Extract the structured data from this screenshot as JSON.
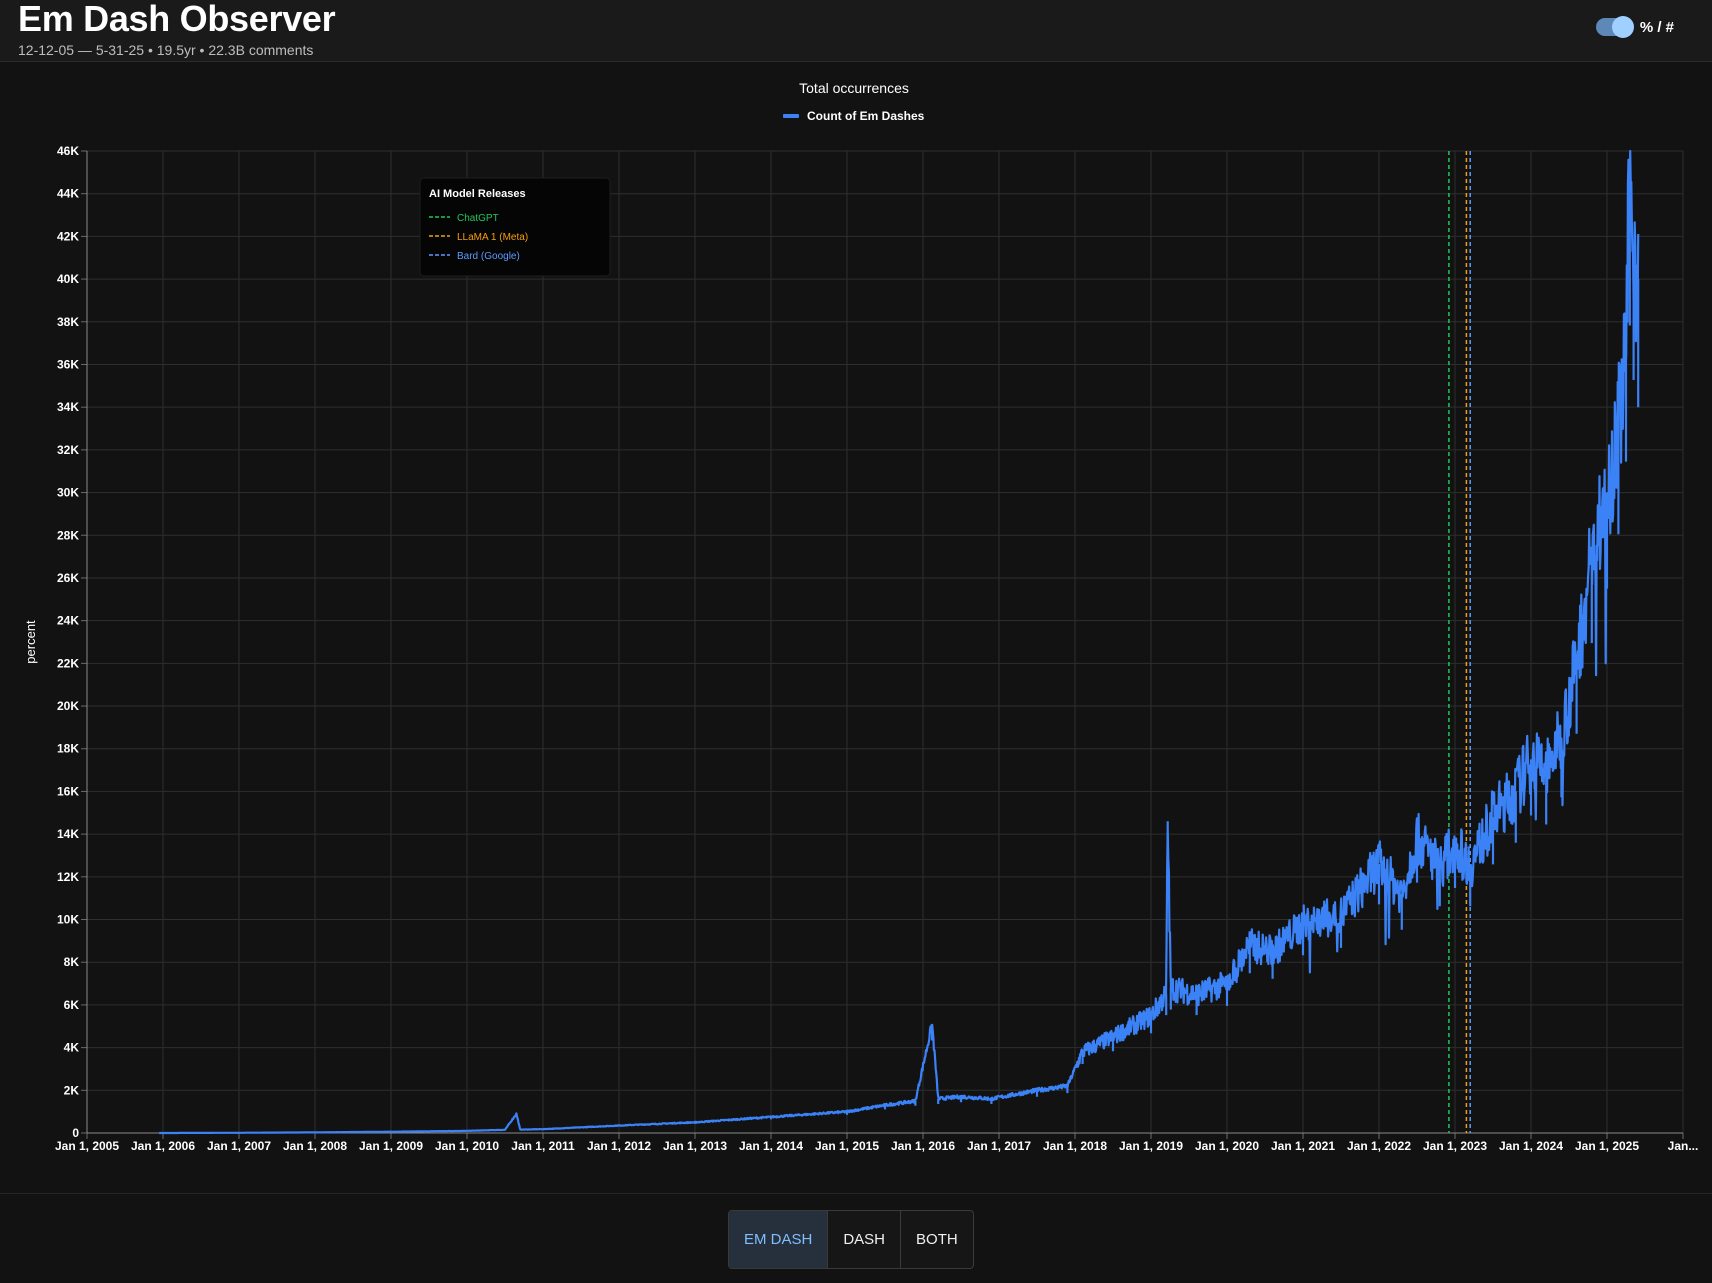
{
  "header": {
    "title": "Em Dash Observer",
    "subtitle": "12-12-05 — 5-31-25 • 19.5yr • 22.3B comments",
    "toggle_label": "% / #"
  },
  "metric_tabs": [
    {
      "label": "EM DASH",
      "active": true
    },
    {
      "label": "DASH",
      "active": false
    },
    {
      "label": "BOTH",
      "active": false
    }
  ],
  "colors": {
    "series": "#3b82f6",
    "chatgpt": "#22c55e",
    "llama": "#f59e0b",
    "bard": "#5b9bff",
    "active_tab_text": "#7fbfff"
  },
  "chart_data": {
    "type": "line",
    "title": "Total occurrences",
    "xlabel": "",
    "ylabel": "percent",
    "legend_position": "top-center",
    "grid": true,
    "xlim": [
      2005.0,
      2026.0
    ],
    "ylim": [
      0,
      46000
    ],
    "x_ticks": [
      "Jan 1, 2005",
      "Jan 1, 2006",
      "Jan 1, 2007",
      "Jan 1, 2008",
      "Jan 1, 2009",
      "Jan 1, 2010",
      "Jan 1, 2011",
      "Jan 1, 2012",
      "Jan 1, 2013",
      "Jan 1, 2014",
      "Jan 1, 2015",
      "Jan 1, 2016",
      "Jan 1, 2017",
      "Jan 1, 2018",
      "Jan 1, 2019",
      "Jan 1, 2020",
      "Jan 1, 2021",
      "Jan 1, 2022",
      "Jan 1, 2023",
      "Jan 1, 2024",
      "Jan 1, 2025",
      "Jan..."
    ],
    "y_ticks": [
      "0",
      "2K",
      "4K",
      "6K",
      "8K",
      "10K",
      "12K",
      "14K",
      "16K",
      "18K",
      "20K",
      "22K",
      "24K",
      "26K",
      "28K",
      "30K",
      "32K",
      "34K",
      "36K",
      "38K",
      "40K",
      "42K",
      "44K",
      "46K"
    ],
    "series": [
      {
        "name": "Count of Em Dashes",
        "points": [
          [
            2005.95,
            0
          ],
          [
            2007.0,
            10
          ],
          [
            2008.0,
            30
          ],
          [
            2009.0,
            60
          ],
          [
            2010.0,
            100
          ],
          [
            2010.5,
            150
          ],
          [
            2010.65,
            900
          ],
          [
            2010.7,
            160
          ],
          [
            2011.0,
            180
          ],
          [
            2012.0,
            350
          ],
          [
            2013.0,
            500
          ],
          [
            2014.0,
            750
          ],
          [
            2015.0,
            1000
          ],
          [
            2015.5,
            1300
          ],
          [
            2015.9,
            1500
          ],
          [
            2016.12,
            5100
          ],
          [
            2016.2,
            1600
          ],
          [
            2016.5,
            1700
          ],
          [
            2016.9,
            1600
          ],
          [
            2017.5,
            2000
          ],
          [
            2017.9,
            2200
          ],
          [
            2018.1,
            3800
          ],
          [
            2018.5,
            4500
          ],
          [
            2019.0,
            5500
          ],
          [
            2019.2,
            6500
          ],
          [
            2019.22,
            14600
          ],
          [
            2019.26,
            6800
          ],
          [
            2019.6,
            6500
          ],
          [
            2020.0,
            7000
          ],
          [
            2020.3,
            8800
          ],
          [
            2020.6,
            8500
          ],
          [
            2021.0,
            9800
          ],
          [
            2021.5,
            10200
          ],
          [
            2022.0,
            12600
          ],
          [
            2022.3,
            11200
          ],
          [
            2022.5,
            13800
          ],
          [
            2022.8,
            12500
          ],
          [
            2023.0,
            13500
          ],
          [
            2023.2,
            12500
          ],
          [
            2023.5,
            14800
          ],
          [
            2023.8,
            16000
          ],
          [
            2024.0,
            17500
          ],
          [
            2024.2,
            17000
          ],
          [
            2024.4,
            18500
          ],
          [
            2024.6,
            22000
          ],
          [
            2024.8,
            27000
          ],
          [
            2025.0,
            30000
          ],
          [
            2025.15,
            33000
          ],
          [
            2025.25,
            37000
          ],
          [
            2025.3,
            44500
          ],
          [
            2025.35,
            41500
          ],
          [
            2025.41,
            40000
          ]
        ]
      }
    ],
    "annotations": {
      "title": "AI Model Releases",
      "lines": [
        {
          "label": "ChatGPT",
          "x": 2022.92,
          "color_key": "chatgpt"
        },
        {
          "label": "LLaMA 1 (Meta)",
          "x": 2023.15,
          "color_key": "llama"
        },
        {
          "label": "Bard (Google)",
          "x": 2023.2,
          "color_key": "bard"
        }
      ]
    }
  }
}
